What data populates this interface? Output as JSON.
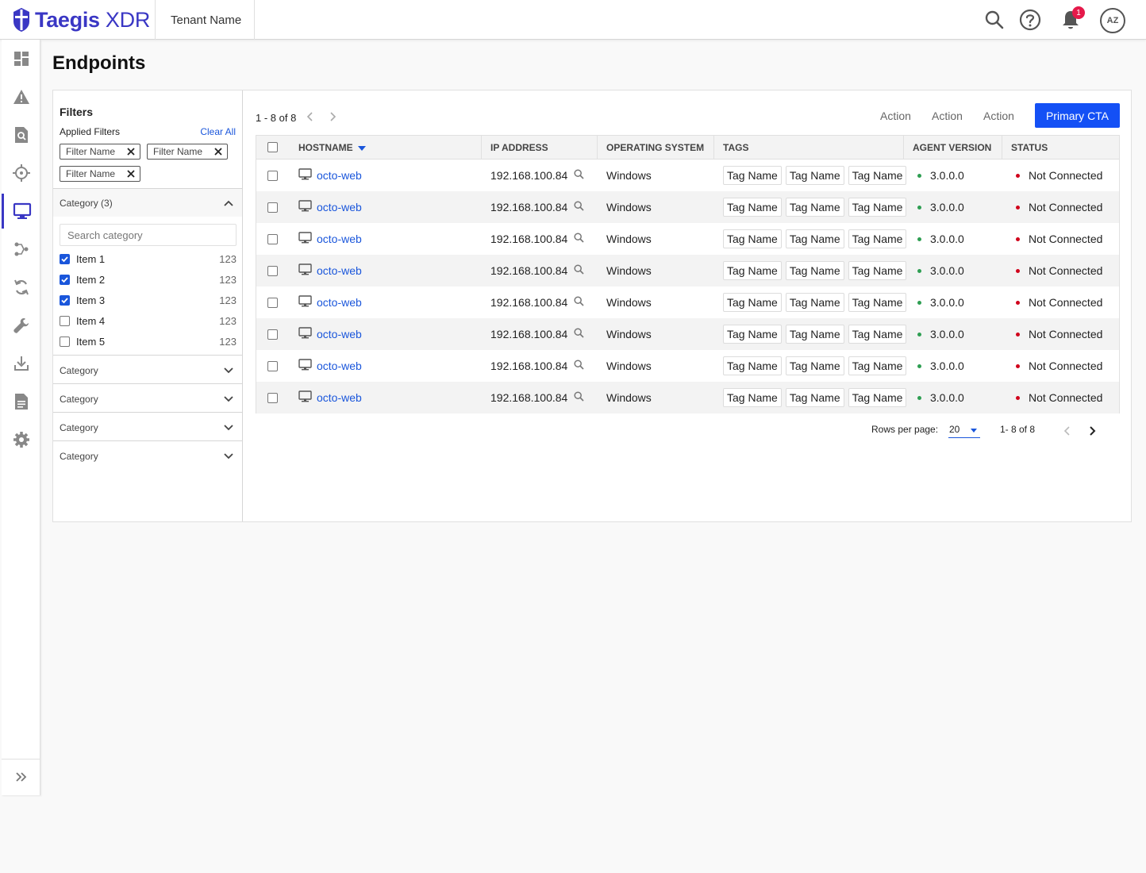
{
  "app": {
    "brand_bold": "Taegis",
    "brand_light": " XDR",
    "tenant": "Tenant Name",
    "notification_count": "1",
    "avatar_initials": "AZ"
  },
  "nav": {
    "items": [
      "dashboard",
      "alerts",
      "investigations",
      "threat-hunting",
      "endpoints",
      "integrations",
      "automation",
      "tools",
      "downloads",
      "reports",
      "settings"
    ],
    "active": "endpoints"
  },
  "page": {
    "title": "Endpoints"
  },
  "filters": {
    "title": "Filters",
    "applied_label": "Applied Filters",
    "clear_all": "Clear All",
    "chips": [
      "Filter Name",
      "Filter Name",
      "Filter Name"
    ],
    "open_category": {
      "label": "Category (3)",
      "search_placeholder": "Search category",
      "items": [
        {
          "label": "Item 1",
          "count": "123",
          "checked": true
        },
        {
          "label": "Item 2",
          "count": "123",
          "checked": true
        },
        {
          "label": "Item 3",
          "count": "123",
          "checked": true
        },
        {
          "label": "Item 4",
          "count": "123",
          "checked": false
        },
        {
          "label": "Item 5",
          "count": "123",
          "checked": false
        }
      ]
    },
    "collapsed_categories": [
      "Category",
      "Category",
      "Category",
      "Category"
    ]
  },
  "toolbar": {
    "range": "1 - 8 of 8",
    "actions": [
      "Action",
      "Action",
      "Action"
    ],
    "primary_cta": "Primary CTA"
  },
  "table": {
    "headers": {
      "hostname": "HOSTNAME",
      "ip": "IP ADDRESS",
      "os": "OPERATING SYSTEM",
      "tags": "TAGS",
      "agent_version": "AGENT VERSION",
      "status": "STATUS"
    },
    "rows": [
      {
        "hostname": "octo-web",
        "ip": "192.168.100.84",
        "os": "Windows",
        "tags": [
          "Tag Name",
          "Tag Name",
          "Tag Name"
        ],
        "agent_version": "3.0.0.0",
        "status": "Not Connected"
      },
      {
        "hostname": "octo-web",
        "ip": "192.168.100.84",
        "os": "Windows",
        "tags": [
          "Tag Name",
          "Tag Name",
          "Tag Name"
        ],
        "agent_version": "3.0.0.0",
        "status": "Not Connected"
      },
      {
        "hostname": "octo-web",
        "ip": "192.168.100.84",
        "os": "Windows",
        "tags": [
          "Tag Name",
          "Tag Name",
          "Tag Name"
        ],
        "agent_version": "3.0.0.0",
        "status": "Not Connected"
      },
      {
        "hostname": "octo-web",
        "ip": "192.168.100.84",
        "os": "Windows",
        "tags": [
          "Tag Name",
          "Tag Name",
          "Tag Name"
        ],
        "agent_version": "3.0.0.0",
        "status": "Not Connected"
      },
      {
        "hostname": "octo-web",
        "ip": "192.168.100.84",
        "os": "Windows",
        "tags": [
          "Tag Name",
          "Tag Name",
          "Tag Name"
        ],
        "agent_version": "3.0.0.0",
        "status": "Not Connected"
      },
      {
        "hostname": "octo-web",
        "ip": "192.168.100.84",
        "os": "Windows",
        "tags": [
          "Tag Name",
          "Tag Name",
          "Tag Name"
        ],
        "agent_version": "3.0.0.0",
        "status": "Not Connected"
      },
      {
        "hostname": "octo-web",
        "ip": "192.168.100.84",
        "os": "Windows",
        "tags": [
          "Tag Name",
          "Tag Name",
          "Tag Name"
        ],
        "agent_version": "3.0.0.0",
        "status": "Not Connected"
      },
      {
        "hostname": "octo-web",
        "ip": "192.168.100.84",
        "os": "Windows",
        "tags": [
          "Tag Name",
          "Tag Name",
          "Tag Name"
        ],
        "agent_version": "3.0.0.0",
        "status": "Not Connected"
      }
    ]
  },
  "pagination": {
    "rows_per_page_label": "Rows per page:",
    "rows_per_page": "20",
    "range": "1- 8 of 8"
  },
  "colors": {
    "brand": "#3a37c4",
    "link": "#1a56db",
    "cta": "#1450f5",
    "agent_ok": "#2e9e52",
    "status_error": "#d0021b"
  }
}
